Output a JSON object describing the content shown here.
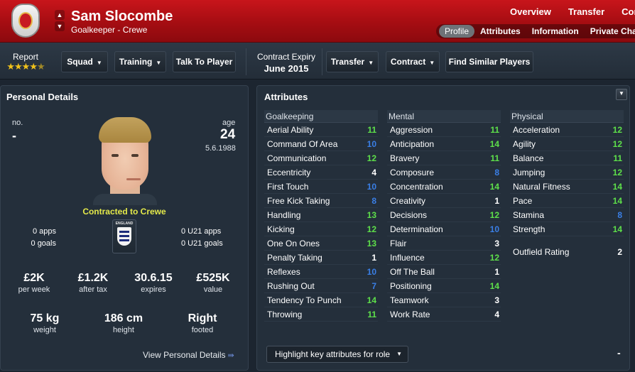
{
  "header": {
    "name": "Sam Slocombe",
    "subtitle": "Goalkeeper - Crewe",
    "top_tabs": [
      "Overview",
      "Transfer",
      "Cont"
    ],
    "sub_tabs": [
      "Profile",
      "Attributes",
      "Information",
      "Private Chat"
    ],
    "active_sub_tab": "Profile",
    "brand_color": "#b3101a"
  },
  "toolbar": {
    "report_label": "Report",
    "report_stars": 4.5,
    "squad": "Squad",
    "training": "Training",
    "talk": "Talk To Player",
    "contract_expiry_label": "Contract Expiry",
    "contract_expiry_value": "June 2015",
    "transfer": "Transfer",
    "contract": "Contract",
    "find_similar": "Find Similar Players"
  },
  "personal": {
    "title": "Personal Details",
    "no_label": "no.",
    "no_value": "-",
    "age_label": "age",
    "age_value": "24",
    "dob": "5.6.1988",
    "contracted": "Contracted to Crewe",
    "nationality_badge": "ENGLAND",
    "apps": "0 apps",
    "goals": "0 goals",
    "u21_apps": "0 U21 apps",
    "u21_goals": "0 U21 goals",
    "wage": {
      "value": "£2K",
      "caption": "per week"
    },
    "after_tax": {
      "value": "£1.2K",
      "caption": "after tax"
    },
    "expires": {
      "value": "30.6.15",
      "caption": "expires"
    },
    "value": {
      "value": "£525K",
      "caption": "value"
    },
    "weight": {
      "value": "75 kg",
      "caption": "weight"
    },
    "height": {
      "value": "186 cm",
      "caption": "height"
    },
    "footed": {
      "value": "Right",
      "caption": "footed"
    },
    "view_link": "View Personal Details"
  },
  "attributes": {
    "title": "Attributes",
    "goalkeeping": {
      "label": "Goalkeeping",
      "items": [
        {
          "name": "Aerial Ability",
          "value": "11",
          "tone": "g"
        },
        {
          "name": "Command Of Area",
          "value": "10",
          "tone": "b"
        },
        {
          "name": "Communication",
          "value": "12",
          "tone": "g"
        },
        {
          "name": "Eccentricity",
          "value": "4",
          "tone": "w"
        },
        {
          "name": "First Touch",
          "value": "10",
          "tone": "b"
        },
        {
          "name": "Free Kick Taking",
          "value": "8",
          "tone": "b"
        },
        {
          "name": "Handling",
          "value": "13",
          "tone": "g"
        },
        {
          "name": "Kicking",
          "value": "12",
          "tone": "g"
        },
        {
          "name": "One On Ones",
          "value": "13",
          "tone": "g"
        },
        {
          "name": "Penalty Taking",
          "value": "1",
          "tone": "w"
        },
        {
          "name": "Reflexes",
          "value": "10",
          "tone": "b"
        },
        {
          "name": "Rushing Out",
          "value": "7",
          "tone": "b"
        },
        {
          "name": "Tendency To Punch",
          "value": "14",
          "tone": "g"
        },
        {
          "name": "Throwing",
          "value": "11",
          "tone": "g"
        }
      ]
    },
    "mental": {
      "label": "Mental",
      "items": [
        {
          "name": "Aggression",
          "value": "11",
          "tone": "g"
        },
        {
          "name": "Anticipation",
          "value": "14",
          "tone": "g"
        },
        {
          "name": "Bravery",
          "value": "11",
          "tone": "g"
        },
        {
          "name": "Composure",
          "value": "8",
          "tone": "b"
        },
        {
          "name": "Concentration",
          "value": "14",
          "tone": "g"
        },
        {
          "name": "Creativity",
          "value": "1",
          "tone": "w"
        },
        {
          "name": "Decisions",
          "value": "12",
          "tone": "g"
        },
        {
          "name": "Determination",
          "value": "10",
          "tone": "b"
        },
        {
          "name": "Flair",
          "value": "3",
          "tone": "w"
        },
        {
          "name": "Influence",
          "value": "12",
          "tone": "g"
        },
        {
          "name": "Off The Ball",
          "value": "1",
          "tone": "w"
        },
        {
          "name": "Positioning",
          "value": "14",
          "tone": "g"
        },
        {
          "name": "Teamwork",
          "value": "3",
          "tone": "w"
        },
        {
          "name": "Work Rate",
          "value": "4",
          "tone": "w"
        }
      ]
    },
    "physical": {
      "label": "Physical",
      "items": [
        {
          "name": "Acceleration",
          "value": "12",
          "tone": "g"
        },
        {
          "name": "Agility",
          "value": "12",
          "tone": "g"
        },
        {
          "name": "Balance",
          "value": "11",
          "tone": "g"
        },
        {
          "name": "Jumping",
          "value": "12",
          "tone": "g"
        },
        {
          "name": "Natural Fitness",
          "value": "14",
          "tone": "g"
        },
        {
          "name": "Pace",
          "value": "14",
          "tone": "g"
        },
        {
          "name": "Stamina",
          "value": "8",
          "tone": "b"
        },
        {
          "name": "Strength",
          "value": "14",
          "tone": "g"
        }
      ]
    },
    "outfield_rating_label": "Outfield Rating",
    "outfield_rating_value": "2",
    "highlight": "Highlight key attributes for role",
    "collapse_label": "-"
  },
  "icons": {
    "crest": "club-crest-icon",
    "nav": "up-down-arrows-icon",
    "stars": "star-rating-icon",
    "caret": "chevron-down-icon",
    "flag": "england-flag-icon",
    "arrow": "double-arrow-right-icon"
  }
}
